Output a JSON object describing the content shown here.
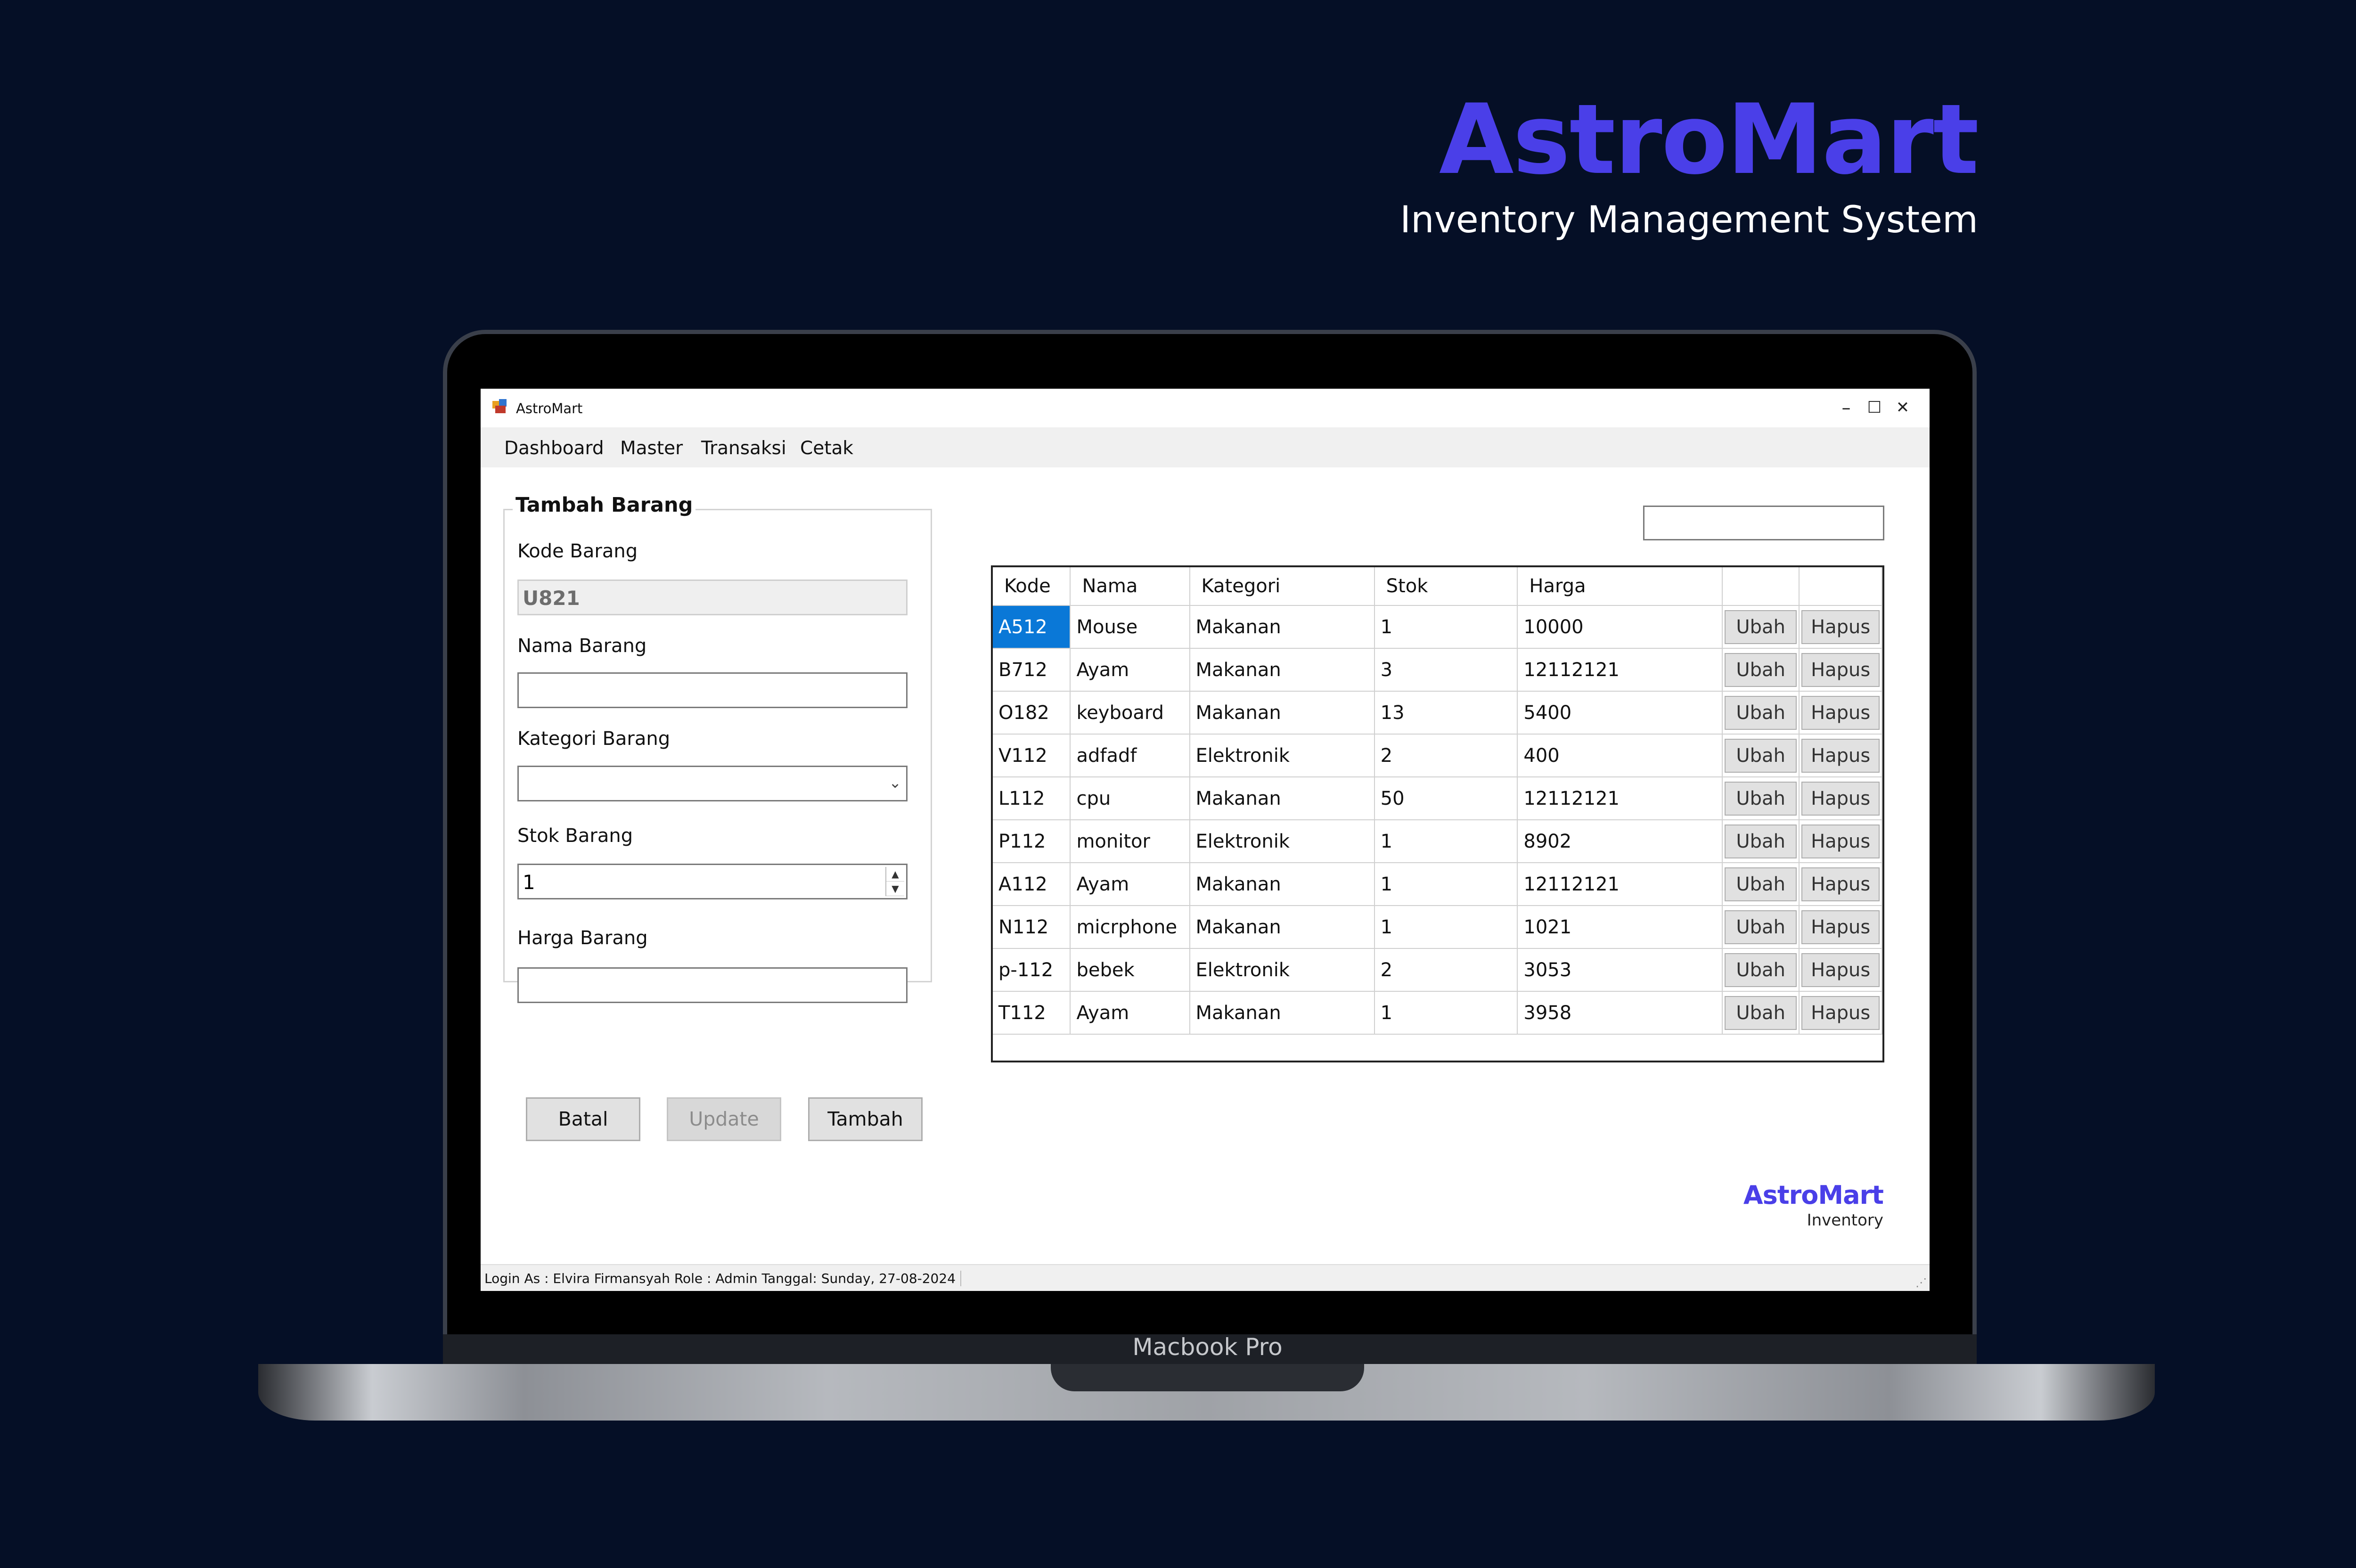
{
  "hero": {
    "title": "AstroMart",
    "subtitle": "Inventory Management System"
  },
  "device": {
    "label": "Macbook Pro"
  },
  "window": {
    "title": "AstroMart",
    "minimize_icon": "–",
    "maximize_icon": "☐",
    "close_icon": "✕"
  },
  "menu": {
    "items": [
      "Dashboard",
      "Master",
      "Transaksi",
      "Cetak"
    ]
  },
  "form": {
    "group_title": "Tambah Barang",
    "kode_label": "Kode Barang",
    "kode_value": "U821",
    "nama_label": "Nama Barang",
    "nama_value": "",
    "kategori_label": "Kategori Barang",
    "kategori_value": "",
    "stok_label": "Stok Barang",
    "stok_value": "1",
    "harga_label": "Harga Barang",
    "harga_value": "",
    "buttons": {
      "batal": "Batal",
      "update": "Update",
      "tambah": "Tambah"
    }
  },
  "search": {
    "value": ""
  },
  "table": {
    "columns": [
      "Kode",
      "Nama",
      "Kategori",
      "Stok",
      "Harga",
      "",
      ""
    ],
    "edit_label": "Ubah",
    "delete_label": "Hapus",
    "rows": [
      {
        "kode": "A512",
        "nama": "Mouse",
        "kategori": "Makanan",
        "stok": "1",
        "harga": "10000"
      },
      {
        "kode": "B712",
        "nama": "Ayam",
        "kategori": "Makanan",
        "stok": "3",
        "harga": "12112121"
      },
      {
        "kode": "O182",
        "nama": "keyboard",
        "kategori": "Makanan",
        "stok": "13",
        "harga": "5400"
      },
      {
        "kode": "V112",
        "nama": "adfadf",
        "kategori": "Elektronik",
        "stok": "2",
        "harga": "400"
      },
      {
        "kode": "L112",
        "nama": "cpu",
        "kategori": "Makanan",
        "stok": "50",
        "harga": "12112121"
      },
      {
        "kode": "P112",
        "nama": "monitor",
        "kategori": "Elektronik",
        "stok": "1",
        "harga": "8902"
      },
      {
        "kode": "A112",
        "nama": "Ayam",
        "kategori": "Makanan",
        "stok": "1",
        "harga": "12112121"
      },
      {
        "kode": "N112",
        "nama": "micrphone",
        "kategori": "Makanan",
        "stok": "1",
        "harga": "1021"
      },
      {
        "kode": "p-112",
        "nama": "bebek",
        "kategori": "Elektronik",
        "stok": "2",
        "harga": "3053"
      },
      {
        "kode": "T112",
        "nama": "Ayam",
        "kategori": "Makanan",
        "stok": "1",
        "harga": "3958"
      }
    ]
  },
  "brand": {
    "name": "AstroMart",
    "sub": "Inventory"
  },
  "status": {
    "text": "Login As :   Elvira Firmansyah   Role :   Admin   Tanggal:   Sunday, 27-08-2024"
  },
  "colors": {
    "background": "#050f26",
    "accent": "#4a3fe8",
    "selection": "#0a78d7"
  }
}
